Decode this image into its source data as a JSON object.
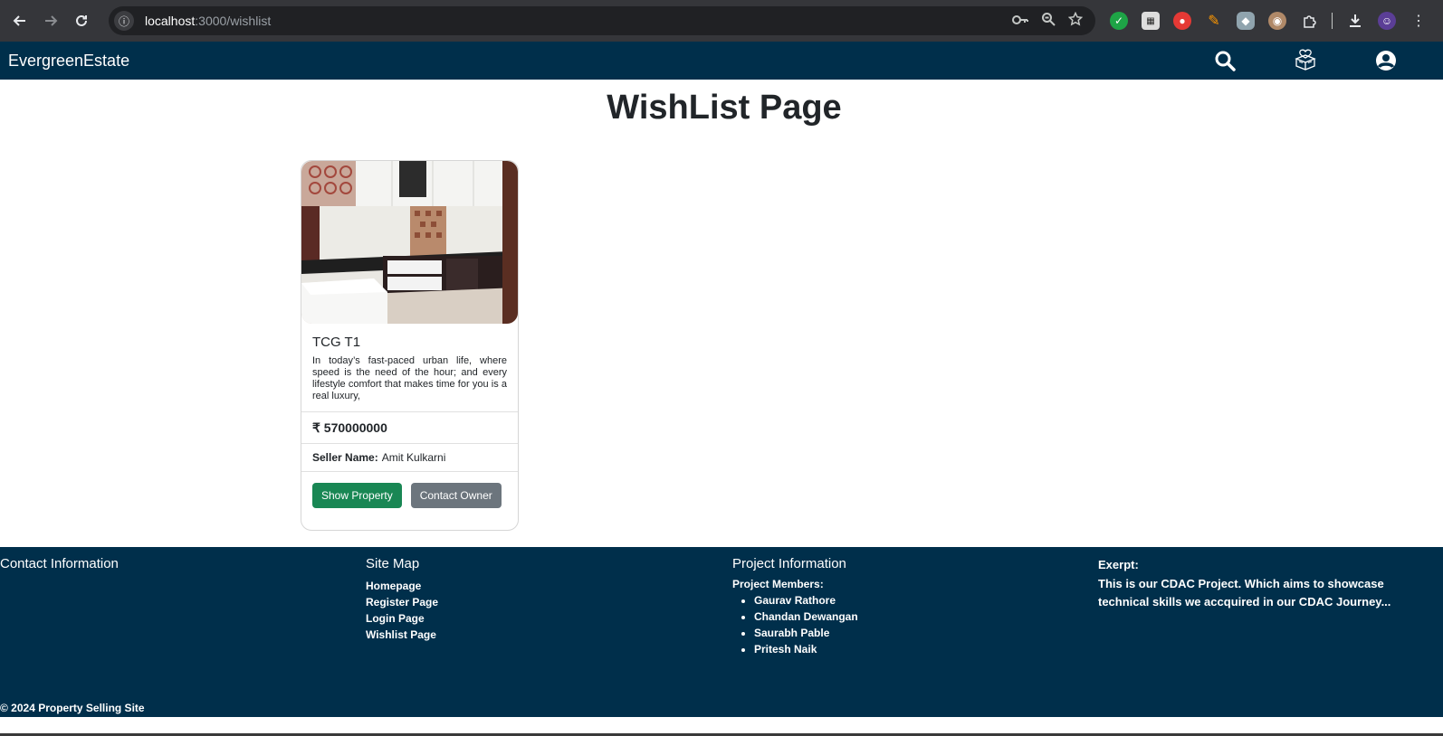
{
  "browser": {
    "url_host": "localhost",
    "url_path": ":3000/wishlist",
    "icons": [
      "back-icon",
      "forward-icon",
      "reload-icon",
      "site-info-icon",
      "password-key-icon",
      "zoom-icon",
      "bookmark-star-icon",
      "extensions-icon",
      "download-icon",
      "profile-avatar-icon",
      "menu-icon"
    ]
  },
  "navbar": {
    "brand": "EvergreenEstate",
    "icons": [
      "search-icon",
      "wishlist-icon",
      "user-account-icon"
    ],
    "color": "#002f4b"
  },
  "main": {
    "title": "WishList Page",
    "cards": [
      {
        "title": "TCG T1",
        "description": "In today’s fast-paced urban life, where speed is the need of the hour; and every lifestyle comfort that makes time for you is a real luxury,",
        "price": "₹ 570000000",
        "seller_label": "Seller Name:",
        "seller_name": "Amit Kulkarni",
        "show_button": "Show Property",
        "contact_button": "Contact Owner"
      }
    ]
  },
  "footer": {
    "contact_heading": "Contact Information",
    "sitemap_heading": "Site Map",
    "sitemap_links": [
      "Homepage",
      "Register Page",
      "Login Page",
      "Wishlist Page"
    ],
    "project_heading": "Project Information",
    "members_label": "Project Members:",
    "members": [
      "Gaurav Rathore",
      "Chandan Dewangan",
      "Saurabh Pable",
      "Pritesh Naik"
    ],
    "excerpt_heading": "Exerpt:",
    "excerpt_text": "This is our CDAC Project. Which aims to showcase technical skills we accquired in our CDAC Journey...",
    "copyright": "© 2024 Property Selling Site"
  },
  "colors": {
    "primary_green": "#198754",
    "secondary_gray": "#6c757d",
    "navy": "#002f4b"
  }
}
